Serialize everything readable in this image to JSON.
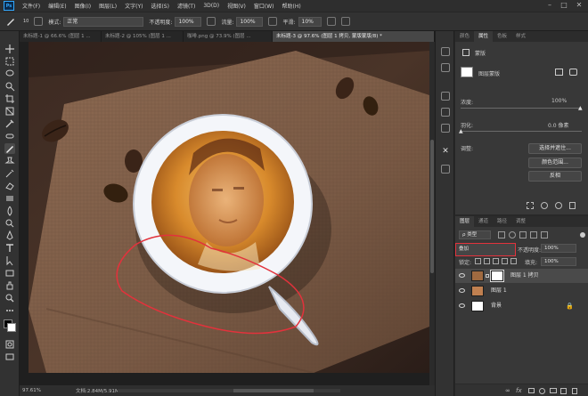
{
  "menu": {
    "logo": "Ps",
    "items": [
      "文件(F)",
      "编辑(E)",
      "图像(I)",
      "图层(L)",
      "文字(Y)",
      "选择(S)",
      "滤镜(T)",
      "3D(D)",
      "视图(V)",
      "窗口(W)",
      "帮助(H)"
    ]
  },
  "options": {
    "mode_label": "模式:",
    "mode_value": "正常",
    "opacity_label": "不透明度:",
    "opacity_value": "100%",
    "flow_label": "流量:",
    "flow_value": "100%",
    "smooth_label": "平滑:",
    "smooth_value": "10%",
    "brush_size": "10"
  },
  "tabs": [
    {
      "label": "未标题-1 @ 66.6% (图层 1 ..."
    },
    {
      "label": "未标题-2 @ 105% (图层 1 ..."
    },
    {
      "label": "咖啡.png @ 73.9% (图层 ..."
    },
    {
      "label": "未标题-3 @ 97.6% (图层 1 拷贝, 蒙版蒙版/8) *"
    }
  ],
  "status": {
    "zoom": "97.61%",
    "doc": "文档:2.84M/5.91M"
  },
  "properties": {
    "tabs": [
      "颜色",
      "属性",
      "色板",
      "样式"
    ],
    "mask_label": "蒙版",
    "layer_mask_label": "图层蒙版",
    "density_label": "浓度:",
    "density_value": "100%",
    "feather_label": "羽化:",
    "feather_value": "0.0 像素",
    "adjust_label": "调整:",
    "buttons": [
      "选择并遮住...",
      "颜色范围...",
      "反相"
    ]
  },
  "layers": {
    "tabs": [
      "图层",
      "通道",
      "路径",
      "调整"
    ],
    "filter_label": "ρ 类型",
    "blend_mode": "叠加",
    "opacity_label": "不透明度:",
    "opacity_value": "100%",
    "lock_label": "锁定:",
    "fill_label": "填充:",
    "fill_value": "100%",
    "items": [
      {
        "name": "图层 1 拷贝"
      },
      {
        "name": "图层 1"
      },
      {
        "name": "背景"
      }
    ]
  },
  "colors": {
    "accent": "#31a8ff",
    "annotation": "#e2323c"
  }
}
